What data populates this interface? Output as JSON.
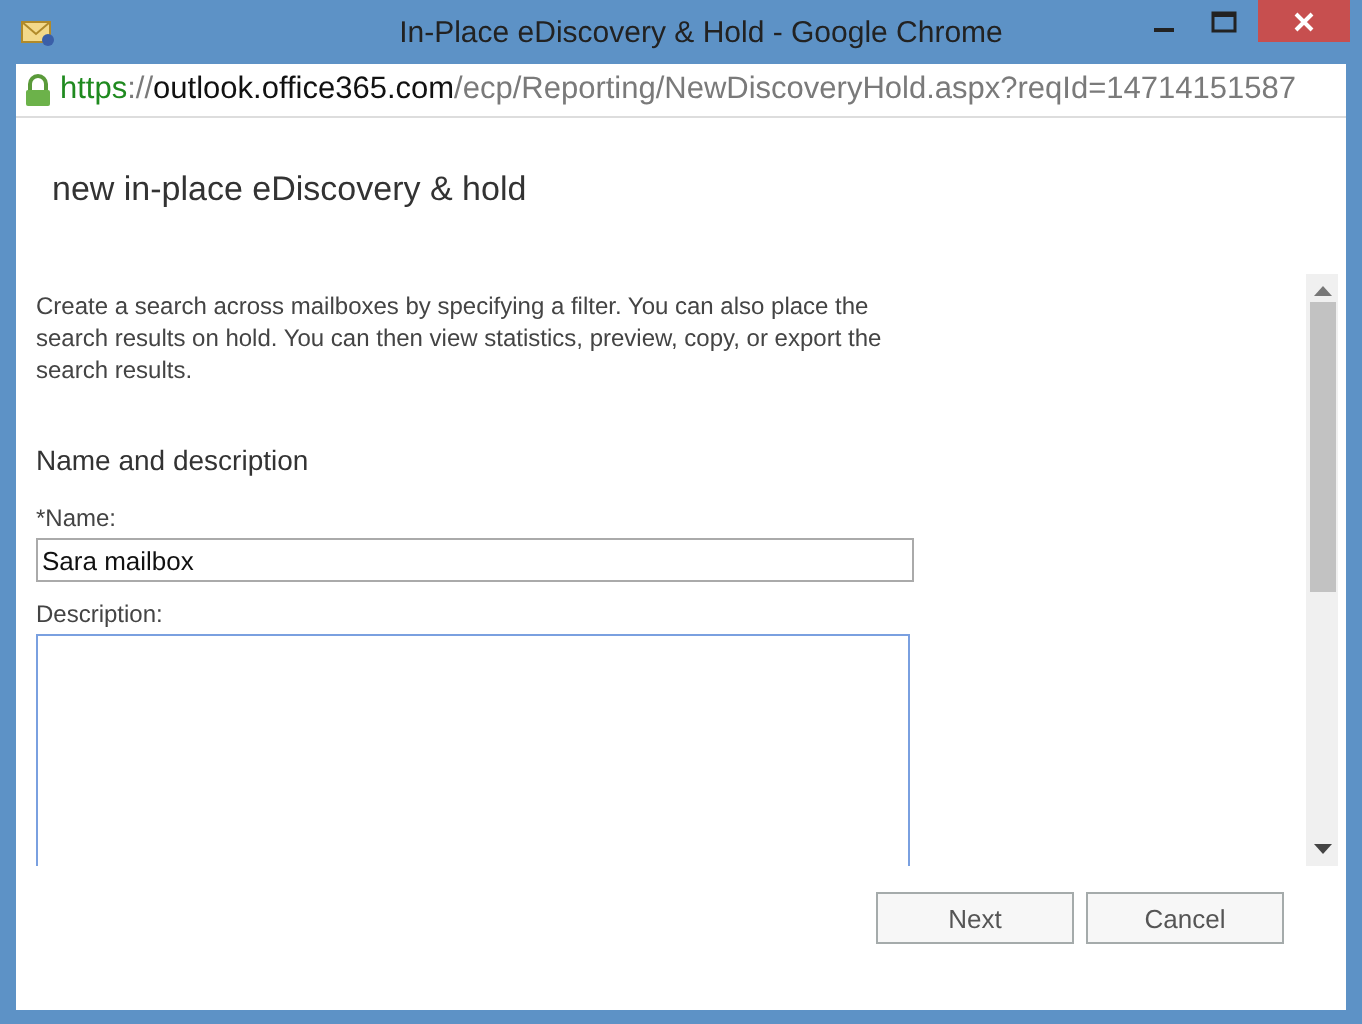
{
  "window": {
    "title": "In-Place eDiscovery & Hold - Google Chrome"
  },
  "address_bar": {
    "scheme": "https",
    "separator": "://",
    "host": "outlook.office365.com",
    "path": "/ecp/Reporting/NewDiscoveryHold.aspx?reqId=14714151587"
  },
  "page": {
    "heading": "new in-place eDiscovery & hold",
    "intro": "Create a search across mailboxes by specifying a filter. You can also place the search results on hold. You can then view statistics, preview, copy, or export the search results.",
    "section": "Name and description",
    "fields": [
      {
        "kind": "input",
        "label": "*Name:",
        "value": "Sara mailbox",
        "focused": false
      },
      {
        "kind": "textarea",
        "label": "Description:",
        "focused": true
      }
    ]
  },
  "buttons": [
    {
      "label": "Next"
    },
    {
      "label": "Cancel"
    }
  ]
}
